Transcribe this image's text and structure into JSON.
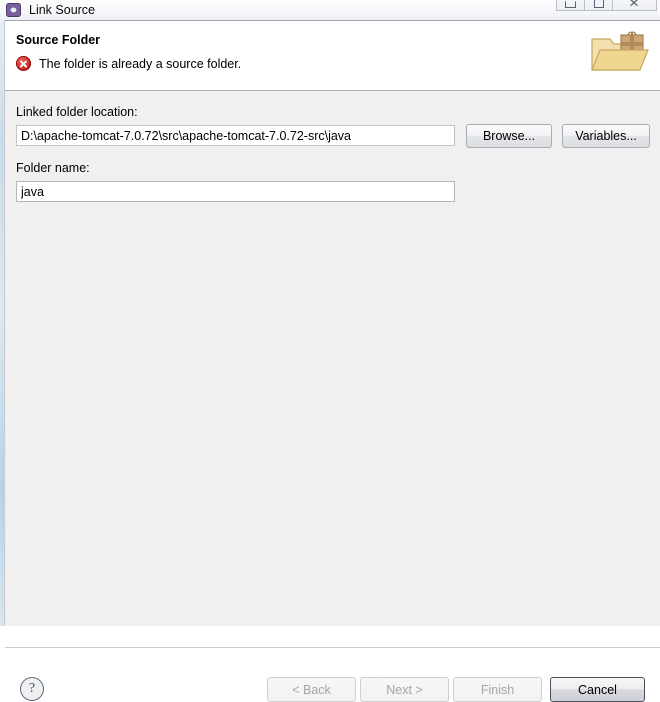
{
  "window": {
    "title": "Link Source",
    "icon": "eclipse-gear-icon",
    "controls": {
      "minimize": "minimize-icon",
      "maximize": "maximize-icon",
      "close": "close-icon"
    }
  },
  "header": {
    "title": "Source Folder",
    "message": "The folder is already a source folder.",
    "message_status": "error",
    "status_icon": "error-circle-x-icon",
    "banner_icon": "folder-with-package-icon"
  },
  "form": {
    "location_label": "Linked folder location:",
    "location_value": "D:\\apache-tomcat-7.0.72\\src\\apache-tomcat-7.0.72-src\\java",
    "location_placeholder": "",
    "browse_label": "Browse...",
    "variables_label": "Variables...",
    "folder_name_label": "Folder name:",
    "folder_name_value": "java",
    "folder_name_placeholder": ""
  },
  "footer": {
    "help_label": "?",
    "back_label": "< Back",
    "next_label": "Next >",
    "finish_label": "Finish",
    "cancel_label": "Cancel",
    "back_enabled": false,
    "next_enabled": false,
    "finish_enabled": false,
    "cancel_enabled": true
  },
  "colors": {
    "dialog_background": "#f0f0f0",
    "header_background": "#ffffff",
    "error_red": "#cf2a26",
    "accent_strip": "#c9dbe8",
    "disabled_text": "#a6a6a6",
    "folder_gold": "#eccf8a"
  }
}
